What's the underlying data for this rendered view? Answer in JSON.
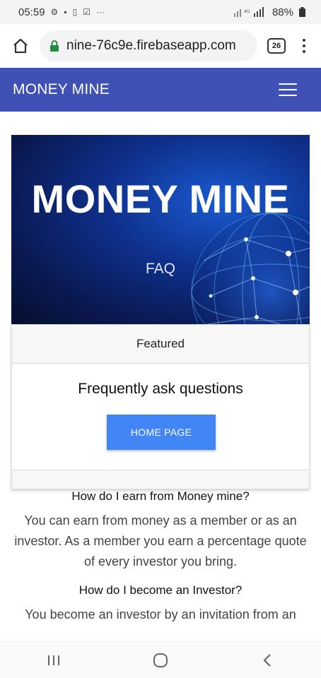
{
  "status_bar": {
    "time": "05:59",
    "more": "···",
    "battery": "88%"
  },
  "browser": {
    "url": "nine-76c9e.firebaseapp.com",
    "tab_count": "26"
  },
  "navbar": {
    "brand": "MONEY MINE"
  },
  "hero": {
    "title": "MONEY MINE",
    "subtitle": "FAQ"
  },
  "card": {
    "header": "Featured",
    "title": "Frequently ask questions",
    "button_label": "HOME PAGE",
    "button_color": "#4285f4"
  },
  "faq": [
    {
      "question": "How do I earn from Money mine?",
      "answer": "You can earn from money as a member or as an investor. As a member you earn a percentage quote of every investor you bring."
    },
    {
      "question": "How do I become an Investor?",
      "answer": "You become an investor by an invitation from an"
    }
  ],
  "colors": {
    "navbar": "#3f51b5",
    "accent": "#4285f4"
  },
  "icons": [
    "home-icon",
    "lock-icon",
    "tabs-icon",
    "more-vert-icon",
    "hamburger-menu-icon",
    "recent-apps-icon",
    "home-circle-icon",
    "back-icon"
  ]
}
